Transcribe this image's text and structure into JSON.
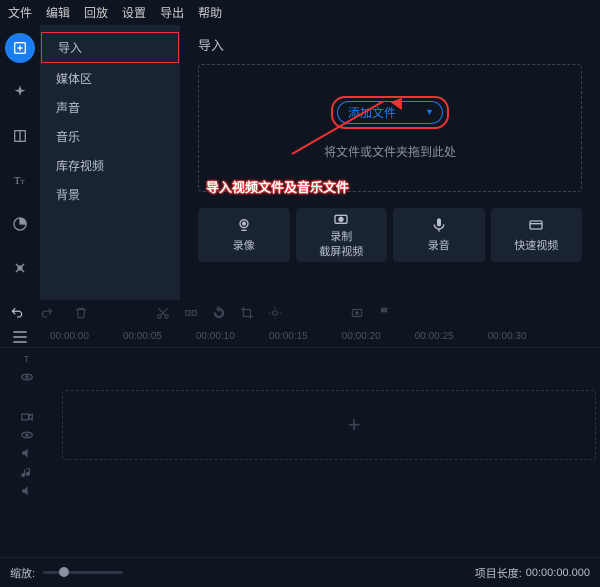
{
  "menubar": [
    "文件",
    "编辑",
    "回放",
    "设置",
    "导出",
    "帮助"
  ],
  "sidebar": {
    "items": [
      {
        "label": "导入",
        "selected": true
      },
      {
        "label": "媒体区"
      },
      {
        "label": "声音"
      },
      {
        "label": "音乐"
      },
      {
        "label": "库存视频"
      },
      {
        "label": "背景"
      }
    ]
  },
  "content": {
    "title": "导入",
    "add_button": "添加文件",
    "drop_msg": "将文件或文件夹拖到此处",
    "annotation": "导入视频文件及音乐文件"
  },
  "capture": [
    {
      "icon": "webcam-icon",
      "label": "录像"
    },
    {
      "icon": "screen-rec-icon",
      "label1": "录制",
      "label2": "截屏视频"
    },
    {
      "icon": "mic-icon",
      "label": "录音"
    },
    {
      "icon": "speed-vid-icon",
      "label": "快速视频"
    }
  ],
  "ruler": [
    "00:00:00",
    "00:00:05",
    "00:00:10",
    "00:00:15",
    "00:00:20",
    "00:00:25",
    "00:00:30"
  ],
  "bottom": {
    "zoom_label": "缩放:",
    "proj_len_label": "项目长度:",
    "proj_len_val": "00:00:00.000"
  }
}
